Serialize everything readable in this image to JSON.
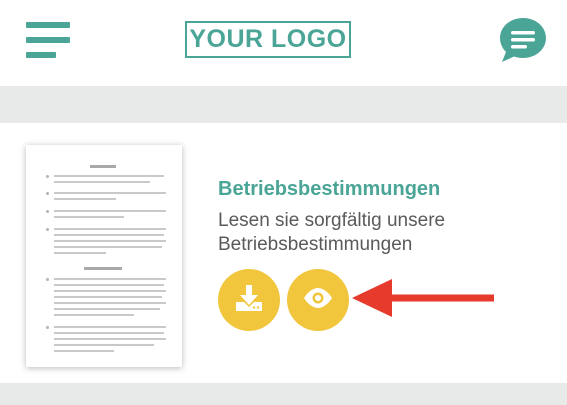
{
  "header": {
    "menu_icon": "hamburger-menu-icon",
    "logo_text": "YOUR LOGO",
    "chat_icon": "chat-bubble-icon"
  },
  "content": {
    "title": "Betriebsbestimmungen",
    "description": "Lesen sie sorgfältig unsere Betriebsbestimmungen",
    "thumbnail": "document-thumbnail",
    "download_icon": "download-icon",
    "view_icon": "eye-icon",
    "pointer": "arrow-left-icon"
  },
  "colors": {
    "accent": "#4aa596",
    "button": "#f1c63c",
    "arrow": "#e53a2c",
    "band": "#e7eae9",
    "text": "#5a5a5a"
  }
}
